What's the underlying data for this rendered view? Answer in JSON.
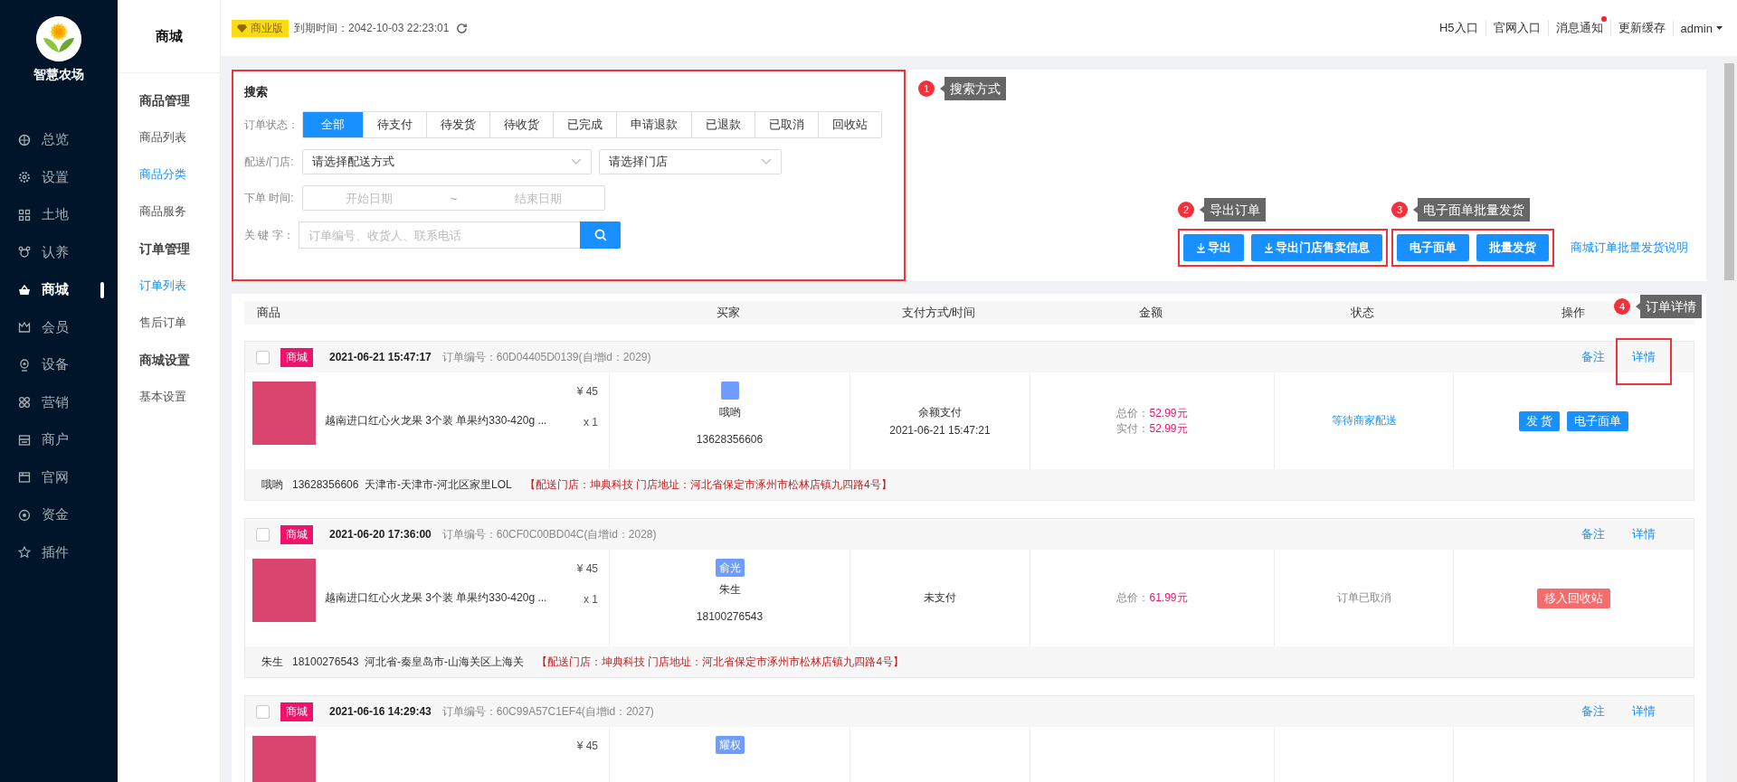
{
  "brand": {
    "name": "智慧农场"
  },
  "nav": [
    {
      "label": "总览",
      "selected": false
    },
    {
      "label": "设置",
      "selected": false
    },
    {
      "label": "土地",
      "selected": false
    },
    {
      "label": "认养",
      "selected": false
    },
    {
      "label": "商城",
      "selected": true
    },
    {
      "label": "会员",
      "selected": false
    },
    {
      "label": "设备",
      "selected": false
    },
    {
      "label": "营销",
      "selected": false
    },
    {
      "label": "商户",
      "selected": false
    },
    {
      "label": "官网",
      "selected": false
    },
    {
      "label": "资金",
      "selected": false
    },
    {
      "label": "插件",
      "selected": false
    }
  ],
  "subnav": {
    "title": "商城",
    "groups": [
      {
        "title": "商品管理",
        "items": [
          {
            "label": "商品列表",
            "selected": false
          },
          {
            "label": "商品分类",
            "selected": true
          },
          {
            "label": "商品服务",
            "selected": false
          }
        ]
      },
      {
        "title": "订单管理",
        "items": [
          {
            "label": "订单列表",
            "selected": true
          },
          {
            "label": "售后订单",
            "selected": false
          }
        ]
      },
      {
        "title": "商城设置",
        "items": [
          {
            "label": "基本设置",
            "selected": false
          }
        ]
      }
    ]
  },
  "topbar": {
    "edition": "商业版",
    "expiry": "到期时间：2042-10-03 22:23:01",
    "links": [
      {
        "label": "H5入口",
        "unread": false
      },
      {
        "label": "官网入口",
        "unread": false
      },
      {
        "label": "消息通知",
        "unread": true
      },
      {
        "label": "更新缓存",
        "unread": false
      }
    ],
    "user": "admin"
  },
  "search": {
    "title": "搜索",
    "callout": {
      "number": "1",
      "text": "搜索方式"
    },
    "status_label": "订单状态：",
    "status_tabs": [
      {
        "label": "全部",
        "selected": true
      },
      {
        "label": "待支付",
        "selected": false
      },
      {
        "label": "待发货",
        "selected": false
      },
      {
        "label": "待收货",
        "selected": false
      },
      {
        "label": "已完成",
        "selected": false
      },
      {
        "label": "申请退款",
        "selected": false
      },
      {
        "label": "已退款",
        "selected": false
      },
      {
        "label": "已取消",
        "selected": false
      },
      {
        "label": "回收站",
        "selected": false
      }
    ],
    "delivery_label": "配送/门店:",
    "delivery_value": "请选择配送方式",
    "store_value": "请选择门店",
    "date_label": "下单 时间:",
    "start_placeholder": "开始日期",
    "separator": "~",
    "end_placeholder": "结束日期",
    "keyword_label": "关 键 字：",
    "keyword_placeholder": "订单编号、收货人、联系电话"
  },
  "toolbar": {
    "groups": [
      {
        "callout": {
          "number": "2",
          "text": "导出订单"
        },
        "buttons": [
          {
            "label": "导出",
            "kind": "download"
          },
          {
            "label": "导出门店售卖信息",
            "kind": "download"
          }
        ]
      },
      {
        "callout": {
          "number": "3",
          "text": "电子面单批量发货"
        },
        "buttons": [
          {
            "label": "电子面单",
            "kind": "plain"
          },
          {
            "label": "批量发货",
            "kind": "plain"
          }
        ]
      }
    ],
    "help_link": "商城订单批量发货说明"
  },
  "table": {
    "columns": [
      "商品",
      "买家",
      "支付方式/时间",
      "金额",
      "状态",
      "操作"
    ],
    "callout": {
      "number": "4",
      "text": "订单详情"
    },
    "orders": [
      {
        "checked": false,
        "tag": "商城",
        "time": "2021-06-21 15:47:17",
        "order_no": "订单编号：60D04405D0139(自增id：2029)",
        "actions": [
          {
            "label": "备注",
            "annotated": false
          },
          {
            "label": "详情",
            "annotated": true
          }
        ],
        "product": {
          "name": "越南进口红心火龙果 3个装 单果约330-420g ...",
          "price": "¥ 45",
          "qty": "x 1"
        },
        "buyer": {
          "name": "哦哟",
          "phone": "13628356606"
        },
        "payment": {
          "method": "余额支付",
          "time": "2021-06-21 15:47:21"
        },
        "amounts": [
          {
            "label": "总价：",
            "value": "52.99元"
          },
          {
            "label": "实付：",
            "value": "52.99元"
          }
        ],
        "status": {
          "text": "等待商家配送",
          "kind": "pending"
        },
        "operations": [
          {
            "label": "发 货",
            "kind": "primary"
          },
          {
            "label": "电子面单",
            "kind": "primary"
          }
        ],
        "footer": {
          "contact": "哦哟   13628356606  天津市-天津市-河北区家里LOL",
          "store": "【配送门店：坤典科技 门店地址：河北省保定市涿州市松林店镇九四路4号】"
        }
      },
      {
        "checked": false,
        "tag": "商城",
        "time": "2021-06-20 17:36:00",
        "order_no": "订单编号：60CF0C00BD04C(自增id：2028)",
        "actions": [
          {
            "label": "备注",
            "annotated": false
          },
          {
            "label": "详情",
            "annotated": false
          }
        ],
        "product": {
          "name": "越南进口红心火龙果 3个装 单果约330-420g ...",
          "price": "¥ 45",
          "qty": "x 1"
        },
        "buyer": {
          "tag": "俞光",
          "name": "朱生",
          "phone": "18100276543"
        },
        "payment": {
          "method": "未支付"
        },
        "amounts": [
          {
            "label": "总价：",
            "value": "61.99元"
          }
        ],
        "status": {
          "text": "订单已取消",
          "kind": "cancelled"
        },
        "operations": [
          {
            "label": "移入回收站",
            "kind": "danger"
          }
        ],
        "footer": {
          "contact": "朱生   18100276543  河北省-秦皇岛市-山海关区上海关",
          "store": "【配送门店：坤典科技 门店地址：河北省保定市涿州市松林店镇九四路4号】"
        }
      },
      {
        "checked": false,
        "tag": "商城",
        "time": "2021-06-16 14:29:43",
        "order_no": "订单编号：60C99A57C1EF4(自增id：2027)",
        "actions": [
          {
            "label": "备注",
            "annotated": false
          },
          {
            "label": "详情",
            "annotated": false
          }
        ],
        "product": {
          "price": "¥ 45"
        },
        "buyer": {
          "tag": "耀权"
        }
      }
    ]
  }
}
